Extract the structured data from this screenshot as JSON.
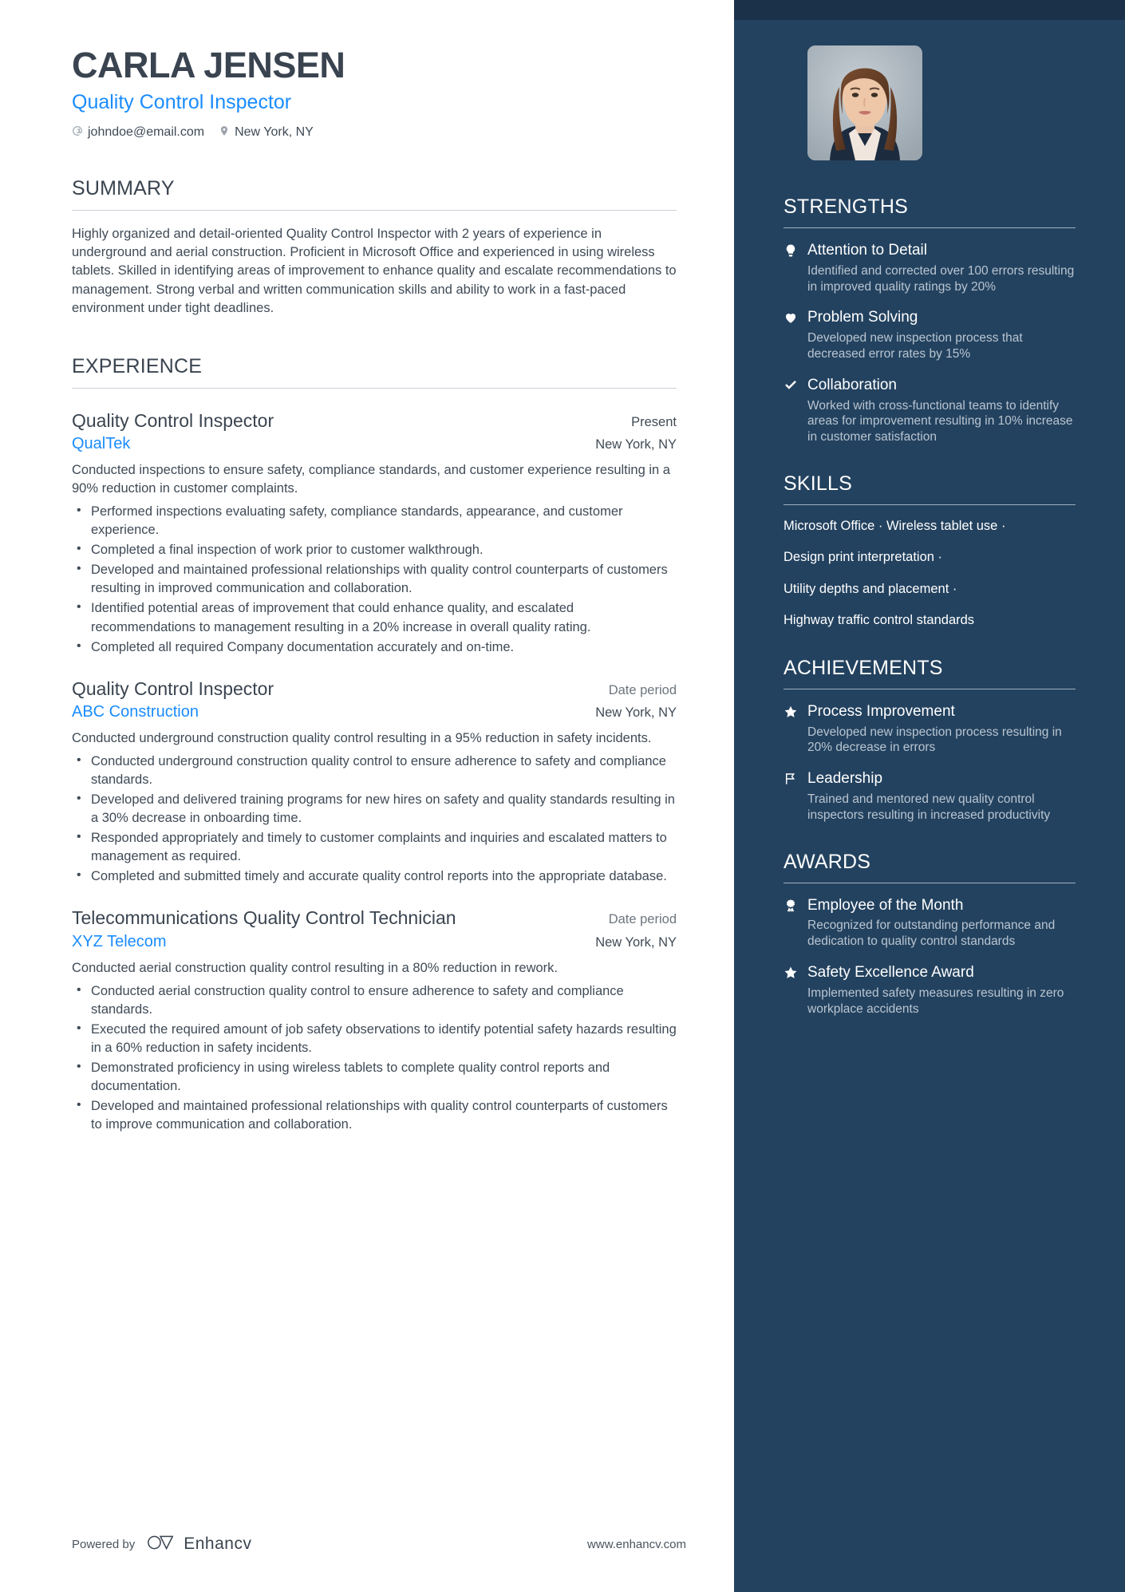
{
  "theme": {
    "sidebar_bg": "#23425f",
    "sidebar_top_strip": "#1b3149",
    "accent_blue": "#1a8cff",
    "heading_gray": "#3a4450",
    "body_gray": "#3f4a56",
    "muted_gray": "#6c757e",
    "sidebar_desc": "#b9c5d1"
  },
  "header": {
    "name": "CARLA JENSEN",
    "role": "Quality Control Inspector",
    "email": "johndoe@email.com",
    "location": "New York, NY",
    "email_icon": "at-sign-icon",
    "location_icon": "map-pin-icon",
    "photo_alt": "profile-photo"
  },
  "summary": {
    "heading": "SUMMARY",
    "text": "Highly organized and detail-oriented Quality Control Inspector with 2 years of experience in underground and aerial construction. Proficient in Microsoft Office and experienced in using wireless tablets. Skilled in identifying areas of improvement to enhance quality and escalate recommendations to management. Strong verbal and written communication skills and ability to work in a fast-paced environment under tight deadlines."
  },
  "experience": {
    "heading": "EXPERIENCE",
    "jobs": [
      {
        "title": "Quality Control Inspector",
        "date": "Present",
        "company": "QualTek",
        "location": "New York, NY",
        "description": "Conducted inspections to ensure safety, compliance standards, and customer experience resulting in a 90% reduction in customer complaints.",
        "bullets": [
          "Performed inspections evaluating safety, compliance standards, appearance, and customer experience.",
          "Completed a final inspection of work prior to customer walkthrough.",
          "Developed and maintained professional relationships with quality control counterparts of customers resulting in improved communication and collaboration.",
          "Identified potential areas of improvement that could enhance quality, and escalated recommendations to management resulting in a 20% increase in overall quality rating.",
          "Completed all required Company documentation accurately and on-time."
        ]
      },
      {
        "title": "Quality Control Inspector",
        "date": "Date period",
        "company": "ABC Construction",
        "location": "New York, NY",
        "description": "Conducted underground construction quality control resulting in a 95% reduction in safety incidents.",
        "bullets": [
          "Conducted underground construction quality control to ensure adherence to safety and compliance standards.",
          "Developed and delivered training programs for new hires on safety and quality standards resulting in a 30% decrease in onboarding time.",
          "Responded appropriately and timely to customer complaints and inquiries and escalated matters to management as required.",
          "Completed and submitted timely and accurate quality control reports into the appropriate database."
        ]
      },
      {
        "title": "Telecommunications Quality Control Technician",
        "date": "Date period",
        "company": "XYZ Telecom",
        "location": "New York, NY",
        "description": "Conducted aerial construction quality control resulting in a 80% reduction in rework.",
        "bullets": [
          "Conducted aerial construction quality control to ensure adherence to safety and compliance standards.",
          "Executed the required amount of job safety observations to identify potential safety hazards resulting in a 60% reduction in safety incidents.",
          "Demonstrated proficiency in using wireless tablets to complete quality control reports and documentation.",
          "Developed and maintained professional relationships with quality control counterparts of customers to improve communication and collaboration."
        ]
      }
    ]
  },
  "strengths": {
    "heading": "STRENGTHS",
    "items": [
      {
        "icon": "lightbulb-icon",
        "title": "Attention to Detail",
        "desc": "Identified and corrected over 100 errors resulting in improved quality ratings by 20%"
      },
      {
        "icon": "heart-icon",
        "title": "Problem Solving",
        "desc": "Developed new inspection process that decreased error rates by 15%"
      },
      {
        "icon": "checkmark-icon",
        "title": "Collaboration",
        "desc": "Worked with cross-functional teams to identify areas for improvement resulting in 10% increase in customer satisfaction"
      }
    ]
  },
  "skills": {
    "heading": "SKILLS",
    "lines": [
      "Microsoft Office · Wireless tablet use ·",
      "Design print interpretation ·",
      "Utility depths and placement ·",
      "Highway traffic control standards"
    ]
  },
  "achievements": {
    "heading": "ACHIEVEMENTS",
    "items": [
      {
        "icon": "star-badge-icon",
        "title": "Process Improvement",
        "desc": "Developed new inspection process resulting in 20% decrease in errors"
      },
      {
        "icon": "flag-icon",
        "title": "Leadership",
        "desc": "Trained and mentored new quality control inspectors resulting in increased productivity"
      }
    ]
  },
  "awards": {
    "heading": "AWARDS",
    "items": [
      {
        "icon": "award-ribbon-icon",
        "title": "Employee of the Month",
        "desc": "Recognized for outstanding performance and dedication to quality control standards"
      },
      {
        "icon": "star-icon",
        "title": "Safety Excellence Award",
        "desc": "Implemented safety measures resulting in zero workplace accidents"
      }
    ]
  },
  "footer": {
    "powered_by": "Powered by",
    "brand": "Enhancv",
    "brand_logo_icon": "enhancv-infinity-icon",
    "url": "www.enhancv.com"
  }
}
